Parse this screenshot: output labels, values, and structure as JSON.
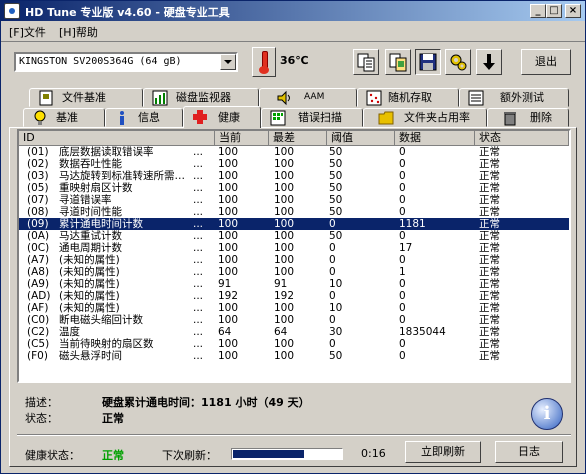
{
  "window": {
    "title": "HD Tune 专业版 v4.60 - 硬盘专业工具",
    "minimize": "_",
    "maximize": "□",
    "close": "×"
  },
  "menu": {
    "file": "[F]文件",
    "help": "[H]帮助"
  },
  "toolbar": {
    "drive": "KINGSTON SV200S364G (64 gB)",
    "temperature": "36℃",
    "exit": "退出",
    "icons": [
      "copy-text-icon",
      "copy-screenshot-icon",
      "save-icon",
      "options-icon",
      "download-icon"
    ]
  },
  "tabs": {
    "row1": [
      "文件基准",
      "磁盘监视器",
      "AAM",
      "随机存取",
      "额外测试"
    ],
    "row2": [
      "基准",
      "信息",
      "健康",
      "错误扫描",
      "文件夹占用率",
      "删除"
    ],
    "active": "健康"
  },
  "table": {
    "headers": [
      "ID",
      "当前",
      "最差",
      "阈值",
      "数据",
      "状态"
    ],
    "selected_index": 6,
    "rows": [
      {
        "id": "(01)",
        "name": "底层数据读取错误率",
        "cur": "100",
        "worst": "100",
        "thr": "50",
        "data": "0",
        "status": "正常"
      },
      {
        "id": "(02)",
        "name": "数据吞吐性能",
        "cur": "100",
        "worst": "100",
        "thr": "50",
        "data": "0",
        "status": "正常"
      },
      {
        "id": "(03)",
        "name": "马达旋转到标准转速所需…",
        "cur": "100",
        "worst": "100",
        "thr": "50",
        "data": "0",
        "status": "正常"
      },
      {
        "id": "(05)",
        "name": "重映射扇区计数",
        "cur": "100",
        "worst": "100",
        "thr": "50",
        "data": "0",
        "status": "正常"
      },
      {
        "id": "(07)",
        "name": "寻道错误率",
        "cur": "100",
        "worst": "100",
        "thr": "50",
        "data": "0",
        "status": "正常"
      },
      {
        "id": "(08)",
        "name": "寻道时间性能",
        "cur": "100",
        "worst": "100",
        "thr": "50",
        "data": "0",
        "status": "正常"
      },
      {
        "id": "(09)",
        "name": "累计通电时间计数",
        "cur": "100",
        "worst": "100",
        "thr": "0",
        "data": "1181",
        "status": "正常"
      },
      {
        "id": "(0A)",
        "name": "马达重试计数",
        "cur": "100",
        "worst": "100",
        "thr": "50",
        "data": "0",
        "status": "正常"
      },
      {
        "id": "(0C)",
        "name": "通电周期计数",
        "cur": "100",
        "worst": "100",
        "thr": "0",
        "data": "17",
        "status": "正常"
      },
      {
        "id": "(A7)",
        "name": "(未知的属性)",
        "cur": "100",
        "worst": "100",
        "thr": "0",
        "data": "0",
        "status": "正常"
      },
      {
        "id": "(A8)",
        "name": "(未知的属性)",
        "cur": "100",
        "worst": "100",
        "thr": "0",
        "data": "1",
        "status": "正常"
      },
      {
        "id": "(A9)",
        "name": "(未知的属性)",
        "cur": "91",
        "worst": "91",
        "thr": "10",
        "data": "0",
        "status": "正常"
      },
      {
        "id": "(AD)",
        "name": "(未知的属性)",
        "cur": "192",
        "worst": "192",
        "thr": "0",
        "data": "0",
        "status": "正常"
      },
      {
        "id": "(AF)",
        "name": "(未知的属性)",
        "cur": "100",
        "worst": "100",
        "thr": "10",
        "data": "0",
        "status": "正常"
      },
      {
        "id": "(C0)",
        "name": "断电磁头缩回计数",
        "cur": "100",
        "worst": "100",
        "thr": "0",
        "data": "0",
        "status": "正常"
      },
      {
        "id": "(C2)",
        "name": "温度",
        "cur": "64",
        "worst": "64",
        "thr": "30",
        "data": "1835044",
        "status": "正常"
      },
      {
        "id": "(C5)",
        "name": "当前待映射的扇区数",
        "cur": "100",
        "worst": "100",
        "thr": "0",
        "data": "0",
        "status": "正常"
      },
      {
        "id": "(F0)",
        "name": "磁头悬浮时间",
        "cur": "100",
        "worst": "100",
        "thr": "50",
        "data": "0",
        "status": "正常"
      }
    ]
  },
  "info": {
    "desc_label": "描述：",
    "desc_value": "硬盘累计通电时间：1181 小时（49 天）",
    "status_label": "状态：",
    "status_value": "正常",
    "icon_letter": "i"
  },
  "footer": {
    "health_label": "健康状态：",
    "health_value": "正常",
    "next_refresh_label": "下次刷新：",
    "progress_fraction": 0.66,
    "countdown": "0:16",
    "refresh_button": "立即刷新",
    "log_button": "日志"
  },
  "colors": {
    "accent": "#0a246a",
    "ok_green": "#00a000",
    "window_face": "#d4d0c8"
  }
}
